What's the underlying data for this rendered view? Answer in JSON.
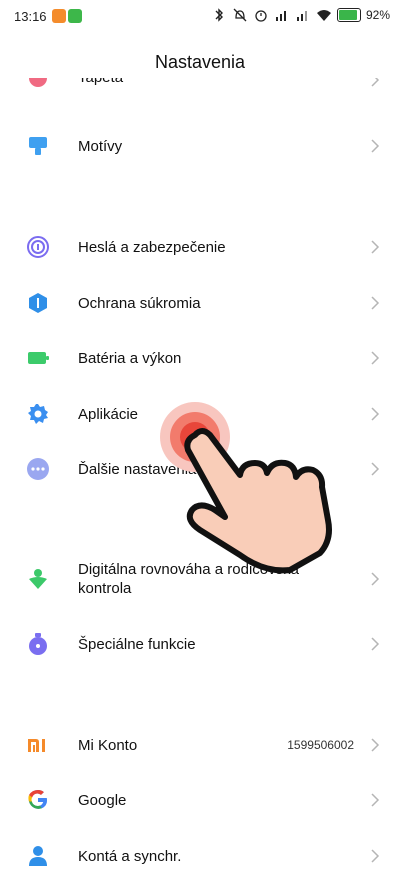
{
  "status_bar": {
    "time": "13:16",
    "battery": "92",
    "battery_suffix": "%"
  },
  "header": {
    "title": "Nastavenia"
  },
  "items": [
    {
      "label": "Tapeta",
      "icon": "wallpaper-icon",
      "color": "#f06a82"
    },
    {
      "label": "Motívy",
      "icon": "themes-icon",
      "color": "#3fa0f0"
    },
    {
      "label": "Heslá a zabezpečenie",
      "icon": "fingerprint-icon",
      "color": "#7b6cf0"
    },
    {
      "label": "Ochrana súkromia",
      "icon": "privacy-shield-icon",
      "color": "#2f8fe8"
    },
    {
      "label": "Batéria a výkon",
      "icon": "battery-icon",
      "color": "#3ccb6b"
    },
    {
      "label": "Aplikácie",
      "icon": "gear-icon",
      "color": "#3a8ff0"
    },
    {
      "label": "Ďalšie nastavenia",
      "icon": "more-dots-icon",
      "color": "#9aa7f0"
    },
    {
      "label": "Digitálna rovnováha a rodičovská kontrola",
      "label_line1": "Digitálna rovnováha a rodičovská",
      "label_line2": "kontrola",
      "icon": "digital-wellbeing-icon",
      "color": "#3cc96a"
    },
    {
      "label": "Špeciálne funkcie",
      "icon": "special-features-icon",
      "color": "#7a6ef0"
    },
    {
      "label": "Mi Konto",
      "value": "1599506002",
      "icon": "mi-logo-icon",
      "color": "#f58a2a"
    },
    {
      "label": "Google",
      "icon": "google-icon",
      "color": "#4285f4"
    },
    {
      "label": "Kontá a synchr.",
      "icon": "account-icon",
      "color": "#2f8fe8"
    }
  ]
}
